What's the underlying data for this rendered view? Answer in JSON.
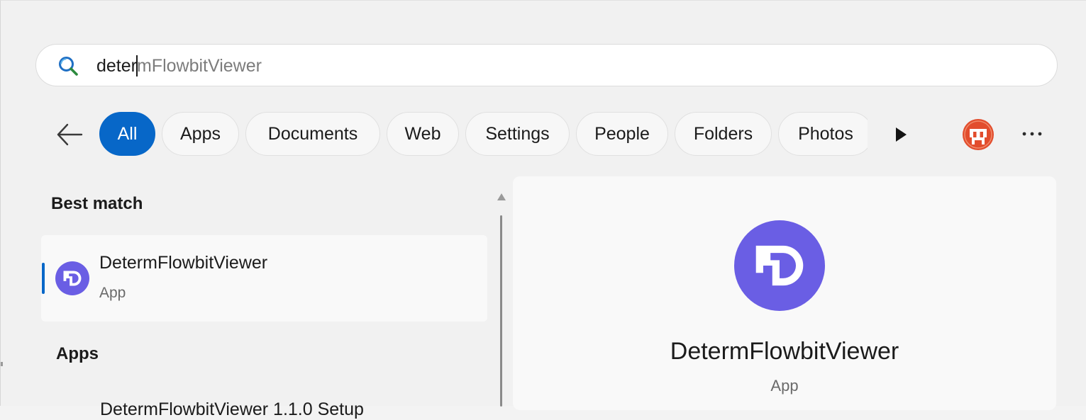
{
  "search": {
    "typed": "deter",
    "suggestion": "mFlowbitViewer"
  },
  "filters": {
    "items": [
      {
        "label": "All"
      },
      {
        "label": "Apps"
      },
      {
        "label": "Documents"
      },
      {
        "label": "Web"
      },
      {
        "label": "Settings"
      },
      {
        "label": "People"
      },
      {
        "label": "Folders"
      },
      {
        "label": "Photos"
      }
    ],
    "active": "All"
  },
  "results": {
    "best_match_heading": "Best match",
    "best_match": {
      "name": "DetermFlowbitViewer",
      "type": "App"
    },
    "apps_heading": "Apps",
    "apps_first_partial": "DetermFlowbitViewer 1.1.0 Setup"
  },
  "detail": {
    "name": "DetermFlowbitViewer",
    "type": "App"
  },
  "colors": {
    "accent": "#0767c8",
    "app_icon": "#6a5ee4",
    "avatar": "#e24d2d"
  },
  "icons": {
    "search": "search-icon",
    "back": "arrow-left-icon",
    "more_filters": "play-icon",
    "account": "avatar",
    "more": "more-options-icon",
    "app": "app-logo-icon"
  }
}
